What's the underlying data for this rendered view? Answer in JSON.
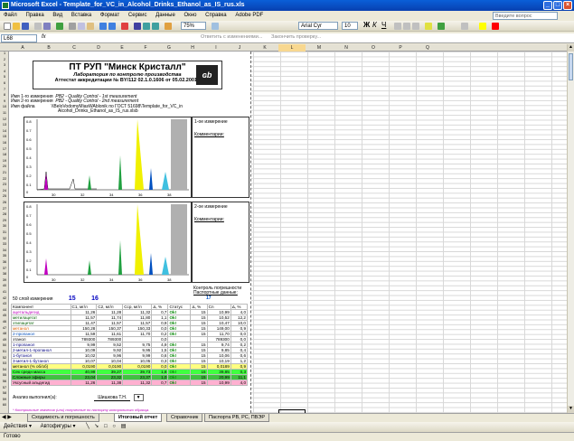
{
  "window": {
    "title": "Microsoft Excel - Template_for_VC_in_Alcohol_Drinks_Ethanol_as_IS_rus.xls"
  },
  "menu": [
    "Файл",
    "Правка",
    "Вид",
    "Вставка",
    "Формат",
    "Сервис",
    "Данные",
    "Окно",
    "Справка",
    "Adobe PDF"
  ],
  "help_placeholder": "Введите вопрос",
  "toolbar": {
    "zoom": "75%",
    "font": "Arial Cyr",
    "size": "10",
    "reply_label": "Ответить с изменениями...",
    "end_review_label": "Закончить проверку..."
  },
  "formula": {
    "namebox": "L68",
    "fx": "fx"
  },
  "columns": [
    "A",
    "B",
    "C",
    "D",
    "E",
    "F",
    "G",
    "H",
    "I",
    "J",
    "K",
    "L",
    "M",
    "N",
    "O",
    "P",
    "Q"
  ],
  "rows_top": [
    "1",
    "2",
    "3",
    "4",
    "5",
    "6",
    "7",
    "8",
    "9",
    "10",
    "11",
    "12",
    "13",
    "14",
    "15",
    "16",
    "17",
    "18",
    "19",
    "20",
    "21",
    "22",
    "23",
    "24",
    "25",
    "26",
    "27",
    "28",
    "29",
    "30",
    "31",
    "32",
    "33",
    "34",
    "35",
    "36",
    "37",
    "38",
    "39",
    "40",
    "41",
    "42",
    "43",
    "44",
    "45",
    "46",
    "47",
    "48",
    "49",
    "50",
    "51",
    "52",
    "53",
    "54",
    "55",
    "56",
    "57",
    "58",
    "59",
    "60"
  ],
  "header": {
    "company": "ПТ РУП \"Минск Кристалл\"",
    "lab": "Лаборатория по контролю производства",
    "accred": "Аттестат аккредитации № BY/112 02.1.0.1606 от 05.02.2001г."
  },
  "meta": [
    {
      "label": "Имя 1-го измерения",
      "value": "PB2 - Quality Control - 1st measurement"
    },
    {
      "label": "Имя 2-го измерения",
      "value": "PB2 - Quality Control - 2nd measurement"
    },
    {
      "label": "Имя файла",
      "value": "\\\\BeloVodomyMiasWAblonik по ГОСТ 51698\\Template_for_VC_in"
    },
    {
      "label": "",
      "value": "Alcohol_Drinks_Ethanol_as_IS_rus.xlsb"
    }
  ],
  "chart1": {
    "side": "1-ое измерение",
    "comment": "Комментарии:",
    "yticks": [
      "0.8",
      "0.7",
      "0.6",
      "0.5",
      "0.4",
      "0.3",
      "0.2",
      "0.1",
      "0"
    ],
    "xticks": [
      "30",
      "32",
      "34",
      "36",
      "38"
    ]
  },
  "chart2": {
    "side": "2-ое измерение",
    "comment": "Комментарии:",
    "yticks": [
      "0.8",
      "0.7",
      "0.6",
      "0.5",
      "0.4",
      "0.3",
      "0.2",
      "0.1",
      "0"
    ],
    "xticks": [
      "30",
      "32",
      "34",
      "36",
      "38"
    ]
  },
  "control": {
    "label1": "Контроль погрешности",
    "label2": "Паспортные данные:",
    "value": "17"
  },
  "results": {
    "title_left": "50 слой измерения",
    "n1": "15",
    "n2": "16",
    "headers": [
      "Компонент",
      "C1, мг/л",
      "C2, мг/л",
      "Cср, мг/л",
      "Δ, %",
      "Статус",
      "Δ, %",
      "Cn",
      "Δ, %"
    ],
    "rows": [
      {
        "name": "ацетальдегид",
        "c1": "11,26",
        "c2": "11,28",
        "cm": "11,32",
        "d": "0,7",
        "st": "Ok!",
        "p": "15",
        "cn": "10,99",
        "dd": "4,0",
        "color": "#c000c0"
      },
      {
        "name": "метилацетат",
        "c1": "11,57",
        "c2": "11,74",
        "cm": "11,80",
        "d": "1,1",
        "st": "Ok!",
        "p": "15",
        "cn": "10,52",
        "dd": "12,2",
        "color": "#006000"
      },
      {
        "name": "этилацетат",
        "c1": "11,47",
        "c2": "11,57",
        "cm": "11,57",
        "d": "0,9",
        "st": "Ok!",
        "p": "15",
        "cn": "10,47",
        "dd": "10,0",
        "color": "#006000"
      },
      {
        "name": "метанол",
        "c1": "150,28",
        "c2": "150,37",
        "cm": "150,33",
        "d": "0,0",
        "st": "Ok!",
        "p": "15",
        "cn": "149,00",
        "dd": "0,9",
        "color": "#e06000"
      },
      {
        "name": "2-пропанол",
        "c1": "11,59",
        "c2": "11,61",
        "cm": "11,70",
        "d": "0,2",
        "st": "Ok!",
        "p": "15",
        "cn": "11,70",
        "dd": "0,0",
        "color": "#0050c0"
      },
      {
        "name": "этанол",
        "c1": "789300",
        "c2": "789300",
        "cm": "",
        "d": "0,0",
        "st": "",
        "p": "",
        "cn": "789300",
        "dd": "0,0",
        "color": "#000"
      },
      {
        "name": "1-пропанол",
        "c1": "9,99",
        "c2": "9,52",
        "cm": "9,75",
        "d": "4,9",
        "st": "Ok!",
        "p": "15",
        "cn": "9,74",
        "dd": "0,2",
        "color": "#000080"
      },
      {
        "name": "2-метил-1-пропанол",
        "c1": "10,09",
        "c2": "9,92",
        "cm": "9,95",
        "d": "1,5",
        "st": "Ok!",
        "p": "15",
        "cn": "9,85",
        "dd": "0,4",
        "color": "#000080"
      },
      {
        "name": "1-бутанол",
        "c1": "10,02",
        "c2": "9,96",
        "cm": "9,99",
        "d": "0,6",
        "st": "Ok!",
        "p": "15",
        "cn": "10,06",
        "dd": "0,6",
        "color": "#000080"
      },
      {
        "name": "3-метил-1-бутанол",
        "c1": "10,07",
        "c2": "10,04",
        "cm": "10,05",
        "d": "0,3",
        "st": "Ok!",
        "p": "15",
        "cn": "10,19",
        "dd": "1,2",
        "color": "#000080"
      },
      {
        "name": "метанол (% об/об)",
        "c1": "0,0190",
        "c2": "0,0190",
        "cm": "0,0190",
        "d": "0,0",
        "st": "Ok!",
        "p": "15",
        "cn": "0,0189",
        "dd": "0,9",
        "color": "#000",
        "bg": "#ffff80"
      },
      {
        "name": "Сех средн масса",
        "c1": "40,99",
        "c2": "39,27",
        "cm": "39,73",
        "d": "1,8",
        "st": "Ok!",
        "p": "15",
        "cn": "39,85",
        "dd": "0,3",
        "color": "#000",
        "bg": "#40ff40"
      },
      {
        "name": "Сложные эфиры",
        "c1": "23,04",
        "c2": "23,32",
        "cm": "23,37",
        "d": "1,0",
        "st": "Ok!",
        "p": "15",
        "cn": "20,99",
        "dd": "11,1",
        "color": "#000",
        "bg": "#40c040"
      },
      {
        "name": "Уксусный альдегид",
        "c1": "11,26",
        "c2": "11,38",
        "cm": "11,32",
        "d": "0,7",
        "st": "Ok!",
        "p": "15",
        "cn": "10,99",
        "dd": "4,0",
        "color": "#000",
        "bg": "#ffb0d0"
      }
    ],
    "performer_label": "Анализ выполнил(а):",
    "performer": "Шишкова Т.Н.",
    "footnote": "* Контрольные значения (или) полученные по паспорту контрольного образца."
  },
  "tabs": [
    "Сходимость и погрешность",
    "Итоговый отчет",
    "Справочник",
    "Паспорта РВ, РС, ПВЭР"
  ],
  "active_tab": "Итоговый отчет",
  "drawbar": {
    "draw": "Действия ▾",
    "autoshapes": "Автофигуры ▾"
  },
  "status": "Готово",
  "colors": {
    "accent": "#0a5fd8",
    "ok": "#0a8a0a"
  }
}
